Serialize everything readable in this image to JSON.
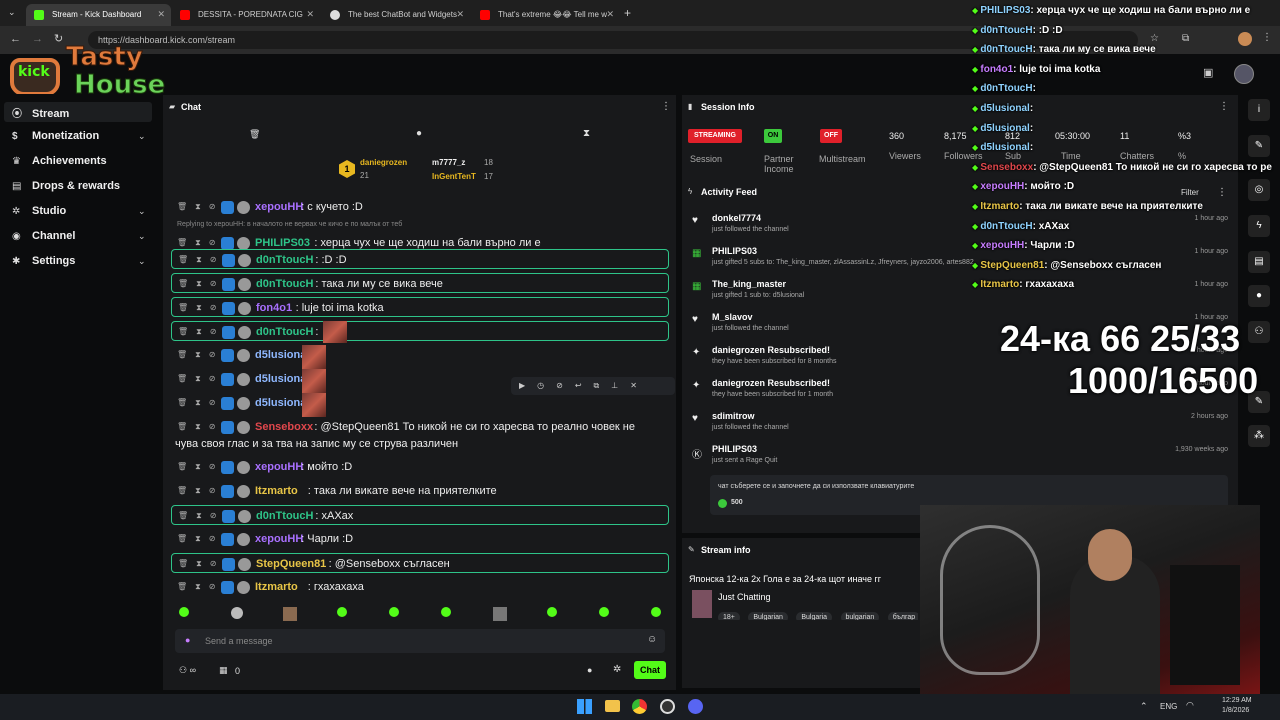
{
  "browser": {
    "tabs": [
      {
        "title": "Stream - Kick Dashboard",
        "active": true
      },
      {
        "title": "DESSITA - POREDNATA CIG"
      },
      {
        "title": "The best ChatBot and Widgets"
      },
      {
        "title": "That's extreme 😂😂 Tell me w"
      }
    ],
    "url": "https://dashboard.kick.com/stream"
  },
  "logo": {
    "line1": "Tasty",
    "line2": "House",
    "kick": "kick"
  },
  "sidebar": {
    "items": [
      {
        "label": "Stream",
        "icon": "signal-icon"
      },
      {
        "label": "Monetization",
        "icon": "dollar-icon"
      },
      {
        "label": "Achievements",
        "icon": "trophy-icon"
      },
      {
        "label": "Drops & rewards",
        "icon": "gift-icon"
      },
      {
        "label": "Studio",
        "icon": "gear-icon"
      },
      {
        "label": "Channel",
        "icon": "globe-icon"
      },
      {
        "label": "Settings",
        "icon": "gear-icon"
      }
    ]
  },
  "chat": {
    "title": "Chat",
    "leaderboard": [
      {
        "rank": "1",
        "name": "daniegrozen",
        "count": "21"
      },
      {
        "name": "m7777_z",
        "count": "18"
      },
      {
        "name": "InGentTenT",
        "count": "17"
      }
    ],
    "reply_note": "Replying to xepouHH: в началото не вервах че кичо е по малък от теб",
    "messages": [
      {
        "user": "xepouHH",
        "color": "#a970ff",
        "text": ": с кучето :D",
        "boxed": false
      },
      {
        "user": "PHILIPS03",
        "color": "#2ec489",
        "text": ": херца чух че ще ходиш на бали върно ли е",
        "boxed": false
      },
      {
        "user": "d0nTtoucH",
        "color": "#2ec489",
        "text": ": :D :D",
        "boxed": true
      },
      {
        "user": "d0nTtoucH",
        "color": "#2ec489",
        "text": ": така ли му се вика вече",
        "boxed": true
      },
      {
        "user": "fon4o1",
        "color": "#a970ff",
        "text": ": luje toi ima kotka",
        "boxed": true
      },
      {
        "user": "d0nTtoucH",
        "color": "#2ec489",
        "text": ":",
        "boxed": true
      },
      {
        "user": "d5lusional",
        "color": "#8fb8ff",
        "text": ":",
        "boxed": false
      },
      {
        "user": "d5lusional",
        "color": "#8fb8ff",
        "text": ":",
        "boxed": false
      },
      {
        "user": "d5lusional",
        "color": "#8fb8ff",
        "text": ":",
        "boxed": false
      },
      {
        "user": "Senseboxx",
        "color": "#e0474c",
        "text": ": @StepQueen81 То никой не си го харесва то реално човек не",
        "boxed": false
      },
      {
        "user": "",
        "color": "#eee",
        "text": "чува своя глас и за тва на запис му се струва различен",
        "boxed": false
      },
      {
        "user": "xepouHH",
        "color": "#a970ff",
        "text": ": мойто :D",
        "boxed": false
      },
      {
        "user": "Itzmarto",
        "color": "#e8c547",
        "text": ": така ли викате вече на приятелките",
        "boxed": false
      },
      {
        "user": "d0nTtoucH",
        "color": "#2ec489",
        "text": ": хАХах",
        "boxed": true
      },
      {
        "user": "xepouHH",
        "color": "#a970ff",
        "text": ": Чарли :D",
        "boxed": false
      },
      {
        "user": "StepQueen81",
        "color": "#e8c547",
        "text": ": @Senseboxx съгласен",
        "boxed": true
      },
      {
        "user": "Itzmarto",
        "color": "#e8c547",
        "text": ": гхахахаха",
        "boxed": false
      }
    ],
    "input_placeholder": "Send a message",
    "footer_count": "0",
    "send_label": "Chat"
  },
  "session": {
    "title": "Session Info",
    "stats": [
      {
        "badge": "STREAMING",
        "label": "Session",
        "badge_color": "#e0202a"
      },
      {
        "badge": "ON",
        "label": "Partner Income",
        "badge_color": "#3cc93c"
      },
      {
        "badge": "OFF",
        "label": "Multistream",
        "badge_color": "#e0202a"
      },
      {
        "value": "360",
        "label": "Viewers"
      },
      {
        "value": "8,175",
        "label": "Followers"
      },
      {
        "value": "812",
        "label": "Sub"
      },
      {
        "value": "05:30:00",
        "label": "Time"
      },
      {
        "value": "11",
        "label": "Chatters"
      },
      {
        "value": "%3",
        "label": "%"
      }
    ]
  },
  "activity": {
    "title": "Activity Feed",
    "filter": "Filter",
    "items": [
      {
        "icon": "heart-icon",
        "user": "donkel7774",
        "detail": "just followed the channel",
        "time": "1 hour ago"
      },
      {
        "icon": "gift-icon",
        "user": "PHILIPS03",
        "detail": "just gifted 5 subs to: The_king_master, zlAssassinLz, Jfreyners, jayzo2006, artes882",
        "time": "1 hour ago"
      },
      {
        "icon": "gift-icon",
        "user": "The_king_master",
        "detail": "just gifted 1 sub to: d5lusional",
        "time": "1 hour ago"
      },
      {
        "icon": "heart-icon",
        "user": "M_slavov",
        "detail": "just followed the channel",
        "time": "1 hour ago"
      },
      {
        "icon": "star-icon",
        "user": "daniegrozen Resubscribed!",
        "detail": "they have been subscribed for 8 months",
        "time": "2 hours ago"
      },
      {
        "icon": "star-icon",
        "user": "daniegrozen Resubscribed!",
        "detail": "they have been subscribed for 1 month",
        "time": "2 hours ago"
      },
      {
        "icon": "heart-icon",
        "user": "sdimitrow",
        "detail": "just followed the channel",
        "time": "2 hours ago"
      },
      {
        "icon": "kick-icon",
        "user": "PHILIPS03",
        "detail": "just sent a Rage Quit",
        "time": "1,930 weeks ago"
      }
    ],
    "rage_message": "чат съберете се и започнете да си използвате клавиатурите",
    "rage_amount": "500"
  },
  "stream_info": {
    "title": "Stream info",
    "stream_title": "Японска 12-ка 2x Гола е за 24-ка щот иначе гг",
    "category": "Just Chatting",
    "tags": [
      "18+",
      "Bulgarian",
      "Bulgaria",
      "bulgarian",
      "българ"
    ]
  },
  "overlay": {
    "lines": [
      {
        "user": "PHILIPS03",
        "text": ": херца чух че ще ходиш на бали върно ли е"
      },
      {
        "user": "d0nTtoucH",
        "text": ": :D :D"
      },
      {
        "user": "d0nTtoucH",
        "text": ": така ли му се вика вече"
      },
      {
        "user": "fon4o1",
        "text": ": luje toi ima kotka"
      },
      {
        "user": "d0nTtoucH",
        "text": ":"
      },
      {
        "user": "d5lusional",
        "text": ":"
      },
      {
        "user": "d5lusional",
        "text": ":"
      },
      {
        "user": "d5lusional",
        "text": ":"
      },
      {
        "user": "Senseboxx",
        "text": ": @StepQueen81 То никой не си го харесва то ре"
      },
      {
        "user": "xepouHH",
        "text": ": мойто :D"
      },
      {
        "user": "Itzmarto",
        "text": ": така ли викате вече на приятелките"
      },
      {
        "user": "d0nTtoucH",
        "text": ": хАХах"
      },
      {
        "user": "xepouHH",
        "text": ": Чарли :D"
      },
      {
        "user": "StepQueen81",
        "text": ": @Senseboxx съгласен"
      },
      {
        "user": "Itzmarto",
        "text": ": гхахахаха"
      }
    ],
    "big1": "24-ка 66 25/33",
    "big2": "1000/16500"
  },
  "taskbar": {
    "lang": "ENG",
    "time": "12:29 AM",
    "date": "1/8/2026"
  }
}
